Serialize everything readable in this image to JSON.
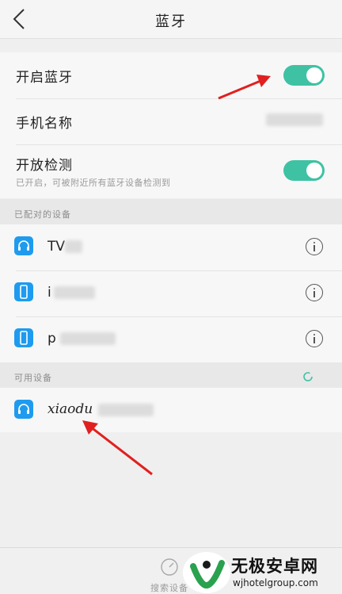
{
  "header": {
    "title": "蓝牙"
  },
  "settings": {
    "bluetooth_label": "开启蓝牙",
    "device_name_label": "手机名称",
    "open_detect_label": "开放检测",
    "open_detect_sub": "已开启，可被附近所有蓝牙设备检测到"
  },
  "paired": {
    "header": "已配对的设备",
    "devices": [
      {
        "name": "TV",
        "icon": "headphones-icon"
      },
      {
        "name": "i",
        "icon": "phone-icon"
      },
      {
        "name": "p",
        "icon": "phone-icon"
      }
    ]
  },
  "available": {
    "header": "可用设备",
    "devices": [
      {
        "name": "xiaodu",
        "icon": "headphones-icon"
      }
    ]
  },
  "bottom": {
    "search_label": "搜索设备"
  },
  "watermark": {
    "brand": "无极安卓网",
    "url": "wjhotelgroup.com"
  },
  "colors": {
    "accent": "#3ec2a3",
    "icon_blue": "#1e9bef",
    "annotation_red": "#e02020"
  }
}
